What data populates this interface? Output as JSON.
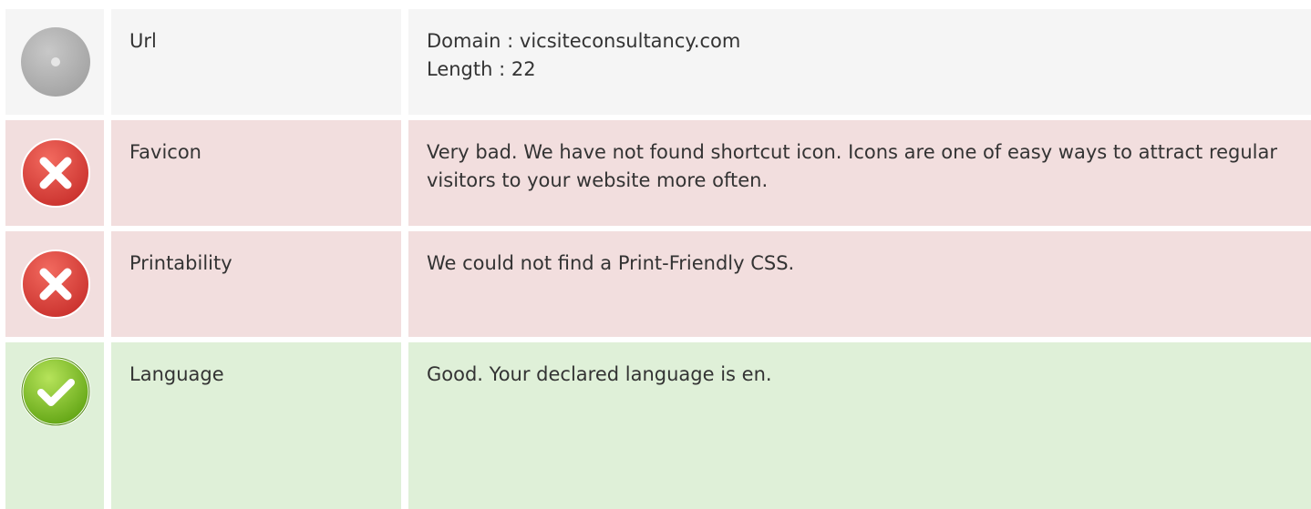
{
  "rows": [
    {
      "status": "neutral",
      "icon": "neutral-dot-icon",
      "name": "Url",
      "lines": [
        "Domain : vicsiteconsultancy.com",
        "Length : 22"
      ]
    },
    {
      "status": "bad",
      "icon": "error-x-icon",
      "name": "Favicon",
      "lines": [
        "Very bad. We have not found shortcut icon. Icons are one of easy ways to attract regular visitors to your website more often."
      ]
    },
    {
      "status": "bad",
      "icon": "error-x-icon",
      "name": "Printability",
      "lines": [
        "We could not find a Print-Friendly CSS."
      ]
    },
    {
      "status": "good",
      "icon": "checkmark-icon",
      "name": "Language",
      "lines": [
        "Good. Your declared language is en."
      ]
    }
  ],
  "colors": {
    "neutral_bg": "#f5f5f5",
    "bad_bg": "#f2dede",
    "good_bg": "#dff0d8",
    "error_red": "#e0403a",
    "success_green": "#7cc21a"
  }
}
